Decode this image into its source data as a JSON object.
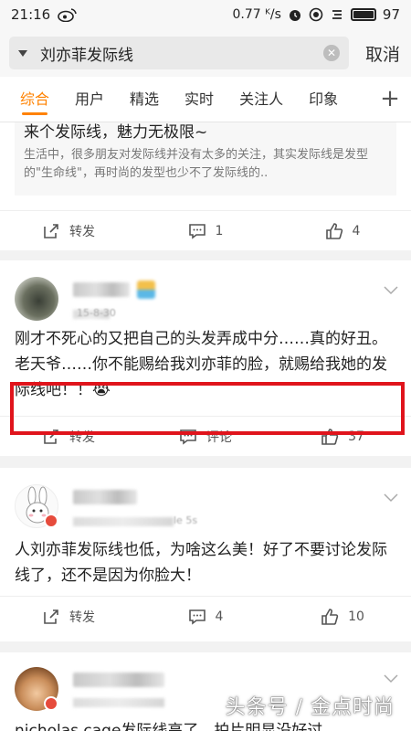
{
  "status_bar": {
    "time": "21:16",
    "speed": "0.77 ᴷ/s",
    "battery": "97",
    "icons": [
      "weibo-icon",
      "alarm-icon",
      "record-icon",
      "signal-icon",
      "battery-icon"
    ]
  },
  "search": {
    "query": "刘亦菲发际线",
    "cancel_label": "取消",
    "icons": [
      "dropdown-caret-icon",
      "clear-icon"
    ]
  },
  "tabs": [
    {
      "label": "综合",
      "active": true
    },
    {
      "label": "用户",
      "active": false
    },
    {
      "label": "精选",
      "active": false
    },
    {
      "label": "实时",
      "active": false
    },
    {
      "label": "关注人",
      "active": false
    },
    {
      "label": "印象",
      "active": false
    }
  ],
  "tab_add_label": "+",
  "posts": [
    {
      "quote_title": "来个发际线，魅力无极限~",
      "quote_desc": "生活中，很多朋友对发际线并没有太多的关注，其实发际线是发型的\"生命线\"，再时尚的发型也少不了发际线的..",
      "repost_label": "转发",
      "comment_label": "1",
      "like_label": "4"
    },
    {
      "meta": "15-8-30",
      "text": "刚才不死心的又把自己的头发弄成中分……真的好丑。老天爷……你不能赐给我刘亦菲的脸，就赐给我她的发际线吧！！😭",
      "repost_label": "转发",
      "comment_label": "评论",
      "like_label": "37"
    },
    {
      "meta": "le 5s",
      "text": "人刘亦菲发际线也低，为啥这么美！好了不要讨论发际线了，还不是因为你脸大！",
      "repost_label": "转发",
      "comment_label": "4",
      "like_label": "10"
    },
    {
      "text": "nicholas cage发际线高了，拍片明显没好过"
    }
  ],
  "watermark": "头条号 / 金点时尚",
  "colors": {
    "accent": "#ff8200",
    "highlight_border": "#e0141c",
    "verified_badge": "#e64b3c"
  }
}
